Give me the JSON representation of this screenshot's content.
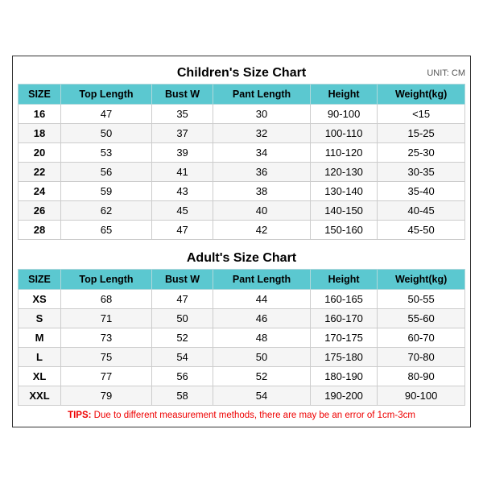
{
  "children_chart": {
    "title": "Children's Size Chart",
    "unit": "UNIT: CM",
    "headers": [
      "SIZE",
      "Top Length",
      "Bust W",
      "Pant Length",
      "Height",
      "Weight(kg)"
    ],
    "rows": [
      [
        "16",
        "47",
        "35",
        "30",
        "90-100",
        "<15"
      ],
      [
        "18",
        "50",
        "37",
        "32",
        "100-110",
        "15-25"
      ],
      [
        "20",
        "53",
        "39",
        "34",
        "110-120",
        "25-30"
      ],
      [
        "22",
        "56",
        "41",
        "36",
        "120-130",
        "30-35"
      ],
      [
        "24",
        "59",
        "43",
        "38",
        "130-140",
        "35-40"
      ],
      [
        "26",
        "62",
        "45",
        "40",
        "140-150",
        "40-45"
      ],
      [
        "28",
        "65",
        "47",
        "42",
        "150-160",
        "45-50"
      ]
    ]
  },
  "adult_chart": {
    "title": "Adult's Size Chart",
    "headers": [
      "SIZE",
      "Top Length",
      "Bust W",
      "Pant Length",
      "Height",
      "Weight(kg)"
    ],
    "rows": [
      [
        "XS",
        "68",
        "47",
        "44",
        "160-165",
        "50-55"
      ],
      [
        "S",
        "71",
        "50",
        "46",
        "160-170",
        "55-60"
      ],
      [
        "M",
        "73",
        "52",
        "48",
        "170-175",
        "60-70"
      ],
      [
        "L",
        "75",
        "54",
        "50",
        "175-180",
        "70-80"
      ],
      [
        "XL",
        "77",
        "56",
        "52",
        "180-190",
        "80-90"
      ],
      [
        "XXL",
        "79",
        "58",
        "54",
        "190-200",
        "90-100"
      ]
    ]
  },
  "tips": {
    "label": "TIPS:",
    "text": " Due to different measurement methods, there are may be an error of 1cm-3cm"
  }
}
